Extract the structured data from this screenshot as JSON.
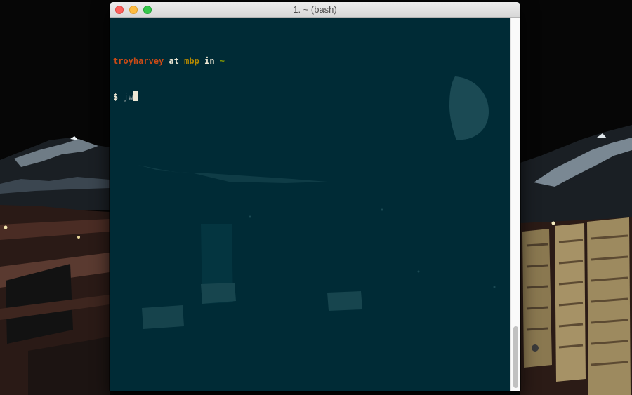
{
  "window": {
    "title": "1. ~ (bash)"
  },
  "terminal": {
    "prompt": {
      "user": "troyharvey",
      "at": "at",
      "host": "mbp",
      "in": "in",
      "path": "~"
    },
    "command_line": {
      "symbol": "$",
      "input": "jw"
    }
  },
  "colors": {
    "terminal_background": "#002b36",
    "user": "#cb4b16",
    "host": "#b58900",
    "path": "#859900",
    "text": "#eee8d5"
  },
  "icons": [
    "close-icon",
    "minimize-icon",
    "zoom-icon"
  ]
}
